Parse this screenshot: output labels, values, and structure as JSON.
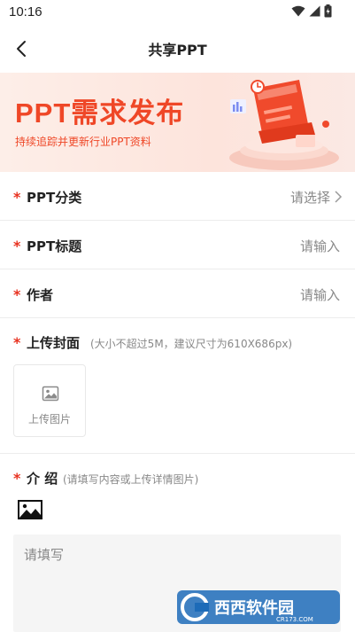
{
  "status_bar": {
    "time": "10:16",
    "icons": [
      "wifi-icon",
      "cellular-signal-icon",
      "battery-icon"
    ]
  },
  "nav": {
    "title": "共享PPT",
    "back_icon": "chevron-left-icon"
  },
  "banner": {
    "title": "PPT需求发布",
    "subtitle": "持续追踪并更新行业PPT资料",
    "colors": {
      "accent": "#ef4727",
      "background": "#fde9e3"
    }
  },
  "form": {
    "required_mark": "*",
    "category": {
      "label": "PPT分类",
      "value": "请选择"
    },
    "title": {
      "label": "PPT标题",
      "placeholder": "请输入"
    },
    "author": {
      "label": "作者",
      "placeholder": "请输入"
    },
    "cover": {
      "label": "上传封面",
      "hint": "(大小不超过5M，建议尺寸为610X686px)",
      "upload_label": "上传图片"
    },
    "intro": {
      "label": "介 绍",
      "hint": "(请填写内容或上传详情图片)",
      "placeholder": "请填写"
    }
  },
  "watermark": {
    "brand": "西西软件园",
    "url": "CR173.COM"
  },
  "colors": {
    "required": "#e8311f",
    "placeholder": "#888888",
    "divider": "#ececec"
  }
}
